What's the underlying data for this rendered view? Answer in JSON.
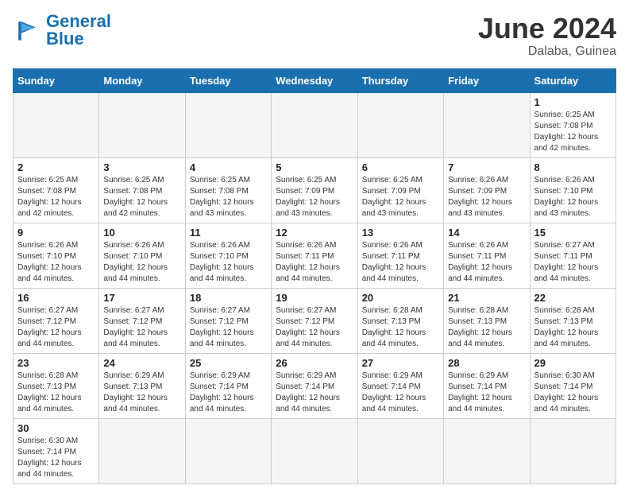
{
  "logo": {
    "text_general": "General",
    "text_blue": "Blue"
  },
  "header": {
    "month_year": "June 2024",
    "location": "Dalaba, Guinea"
  },
  "weekdays": [
    "Sunday",
    "Monday",
    "Tuesday",
    "Wednesday",
    "Thursday",
    "Friday",
    "Saturday"
  ],
  "weeks": [
    [
      {
        "day": "",
        "info": ""
      },
      {
        "day": "",
        "info": ""
      },
      {
        "day": "",
        "info": ""
      },
      {
        "day": "",
        "info": ""
      },
      {
        "day": "",
        "info": ""
      },
      {
        "day": "",
        "info": ""
      },
      {
        "day": "1",
        "info": "Sunrise: 6:25 AM\nSunset: 7:08 PM\nDaylight: 12 hours\nand 42 minutes."
      }
    ],
    [
      {
        "day": "2",
        "info": "Sunrise: 6:25 AM\nSunset: 7:08 PM\nDaylight: 12 hours\nand 42 minutes."
      },
      {
        "day": "3",
        "info": "Sunrise: 6:25 AM\nSunset: 7:08 PM\nDaylight: 12 hours\nand 42 minutes."
      },
      {
        "day": "4",
        "info": "Sunrise: 6:25 AM\nSunset: 7:08 PM\nDaylight: 12 hours\nand 43 minutes."
      },
      {
        "day": "5",
        "info": "Sunrise: 6:25 AM\nSunset: 7:09 PM\nDaylight: 12 hours\nand 43 minutes."
      },
      {
        "day": "6",
        "info": "Sunrise: 6:25 AM\nSunset: 7:09 PM\nDaylight: 12 hours\nand 43 minutes."
      },
      {
        "day": "7",
        "info": "Sunrise: 6:26 AM\nSunset: 7:09 PM\nDaylight: 12 hours\nand 43 minutes."
      },
      {
        "day": "8",
        "info": "Sunrise: 6:26 AM\nSunset: 7:10 PM\nDaylight: 12 hours\nand 43 minutes."
      }
    ],
    [
      {
        "day": "9",
        "info": "Sunrise: 6:26 AM\nSunset: 7:10 PM\nDaylight: 12 hours\nand 44 minutes."
      },
      {
        "day": "10",
        "info": "Sunrise: 6:26 AM\nSunset: 7:10 PM\nDaylight: 12 hours\nand 44 minutes."
      },
      {
        "day": "11",
        "info": "Sunrise: 6:26 AM\nSunset: 7:10 PM\nDaylight: 12 hours\nand 44 minutes."
      },
      {
        "day": "12",
        "info": "Sunrise: 6:26 AM\nSunset: 7:11 PM\nDaylight: 12 hours\nand 44 minutes."
      },
      {
        "day": "13",
        "info": "Sunrise: 6:26 AM\nSunset: 7:11 PM\nDaylight: 12 hours\nand 44 minutes."
      },
      {
        "day": "14",
        "info": "Sunrise: 6:26 AM\nSunset: 7:11 PM\nDaylight: 12 hours\nand 44 minutes."
      },
      {
        "day": "15",
        "info": "Sunrise: 6:27 AM\nSunset: 7:11 PM\nDaylight: 12 hours\nand 44 minutes."
      }
    ],
    [
      {
        "day": "16",
        "info": "Sunrise: 6:27 AM\nSunset: 7:12 PM\nDaylight: 12 hours\nand 44 minutes."
      },
      {
        "day": "17",
        "info": "Sunrise: 6:27 AM\nSunset: 7:12 PM\nDaylight: 12 hours\nand 44 minutes."
      },
      {
        "day": "18",
        "info": "Sunrise: 6:27 AM\nSunset: 7:12 PM\nDaylight: 12 hours\nand 44 minutes."
      },
      {
        "day": "19",
        "info": "Sunrise: 6:27 AM\nSunset: 7:12 PM\nDaylight: 12 hours\nand 44 minutes."
      },
      {
        "day": "20",
        "info": "Sunrise: 6:28 AM\nSunset: 7:13 PM\nDaylight: 12 hours\nand 44 minutes."
      },
      {
        "day": "21",
        "info": "Sunrise: 6:28 AM\nSunset: 7:13 PM\nDaylight: 12 hours\nand 44 minutes."
      },
      {
        "day": "22",
        "info": "Sunrise: 6:28 AM\nSunset: 7:13 PM\nDaylight: 12 hours\nand 44 minutes."
      }
    ],
    [
      {
        "day": "23",
        "info": "Sunrise: 6:28 AM\nSunset: 7:13 PM\nDaylight: 12 hours\nand 44 minutes."
      },
      {
        "day": "24",
        "info": "Sunrise: 6:29 AM\nSunset: 7:13 PM\nDaylight: 12 hours\nand 44 minutes."
      },
      {
        "day": "25",
        "info": "Sunrise: 6:29 AM\nSunset: 7:14 PM\nDaylight: 12 hours\nand 44 minutes."
      },
      {
        "day": "26",
        "info": "Sunrise: 6:29 AM\nSunset: 7:14 PM\nDaylight: 12 hours\nand 44 minutes."
      },
      {
        "day": "27",
        "info": "Sunrise: 6:29 AM\nSunset: 7:14 PM\nDaylight: 12 hours\nand 44 minutes."
      },
      {
        "day": "28",
        "info": "Sunrise: 6:29 AM\nSunset: 7:14 PM\nDaylight: 12 hours\nand 44 minutes."
      },
      {
        "day": "29",
        "info": "Sunrise: 6:30 AM\nSunset: 7:14 PM\nDaylight: 12 hours\nand 44 minutes."
      }
    ],
    [
      {
        "day": "30",
        "info": "Sunrise: 6:30 AM\nSunset: 7:14 PM\nDaylight: 12 hours\nand 44 minutes."
      },
      {
        "day": "",
        "info": ""
      },
      {
        "day": "",
        "info": ""
      },
      {
        "day": "",
        "info": ""
      },
      {
        "day": "",
        "info": ""
      },
      {
        "day": "",
        "info": ""
      },
      {
        "day": "",
        "info": ""
      }
    ]
  ]
}
